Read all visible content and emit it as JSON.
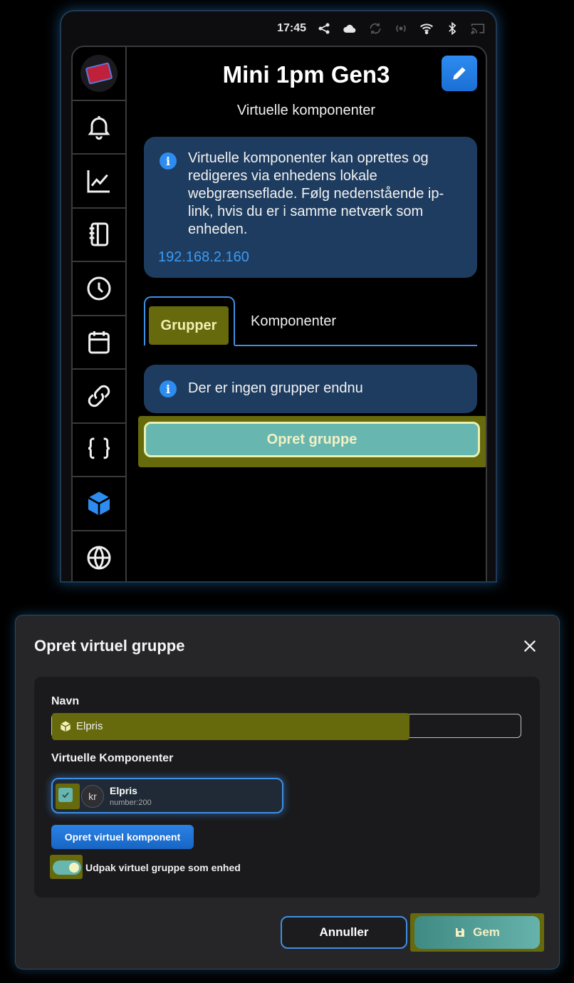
{
  "status_bar": {
    "time": "17:45",
    "icons": [
      "share-icon",
      "cloud-icon",
      "sync-icon",
      "broadcast-icon",
      "wifi-icon",
      "bluetooth-icon",
      "cast-icon"
    ]
  },
  "sidebar": {
    "items": [
      {
        "icon": "device-logo-icon"
      },
      {
        "icon": "bell-icon"
      },
      {
        "icon": "chart-icon"
      },
      {
        "icon": "notebook-icon"
      },
      {
        "icon": "clock-icon"
      },
      {
        "icon": "calendar-icon"
      },
      {
        "icon": "link-icon"
      },
      {
        "icon": "braces-icon"
      },
      {
        "icon": "cube-icon",
        "active": true
      },
      {
        "icon": "globe-icon"
      }
    ]
  },
  "header": {
    "title": "Mini 1pm Gen3",
    "subtitle": "Virtuelle komponenter"
  },
  "info": {
    "text": "Virtuelle komponenter kan oprettes og redigeres via enhedens lokale webgrænseflade. Følg nedenstående ip-link, hvis du er i samme netværk som enheden.",
    "link": "192.168.2.160"
  },
  "tabs": [
    {
      "label": "Grupper",
      "active": true
    },
    {
      "label": "Komponenter",
      "active": false
    }
  ],
  "empty_state": "Der er ingen grupper endnu",
  "create_group_label": "Opret gruppe",
  "dialog": {
    "title": "Opret virtuel gruppe",
    "name_label": "Navn",
    "name_value": "Elpris",
    "components_label": "Virtuelle Komponenter",
    "component": {
      "name": "Elpris",
      "id": "number:200",
      "avatar_text": "kr",
      "checked": true
    },
    "add_component_label": "Opret virtuel komponent",
    "toggle_label": "Udpak virtuel gruppe som enhed",
    "toggle_on": true,
    "cancel_label": "Annuller",
    "save_label": "Gem"
  },
  "colors": {
    "accent": "#3f8fe3",
    "info_bg": "#1e3c5f",
    "teal": "#67b6af",
    "highlight": "#66690c"
  }
}
